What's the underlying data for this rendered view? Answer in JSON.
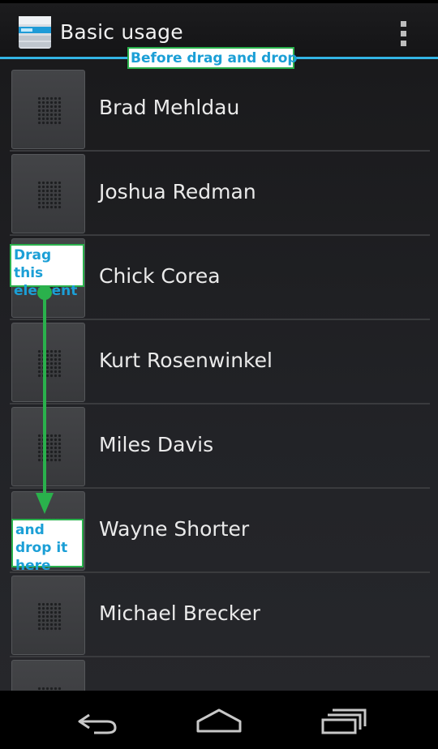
{
  "app": {
    "title": "Basic usage"
  },
  "colors": {
    "accent": "#33b5e5",
    "annotation_border": "#2ab14c",
    "annotation_text": "#1b9fd6"
  },
  "icons": {
    "app": "app-list-icon",
    "overflow": "overflow-menu-icon",
    "drag": "drag-grip-icon",
    "back": "back-icon",
    "home": "home-icon",
    "recents": "recent-apps-icon"
  },
  "list": {
    "items": [
      {
        "label": "Brad Mehldau"
      },
      {
        "label": "Joshua Redman"
      },
      {
        "label": "Chick Corea"
      },
      {
        "label": "Kurt Rosenwinkel"
      },
      {
        "label": "Miles Davis"
      },
      {
        "label": "Wayne Shorter"
      },
      {
        "label": "Michael Brecker"
      },
      {
        "label": ""
      }
    ]
  },
  "annotations": {
    "top": "Before drag and drop",
    "drag": "Drag this element",
    "drop": "and drop it here"
  }
}
